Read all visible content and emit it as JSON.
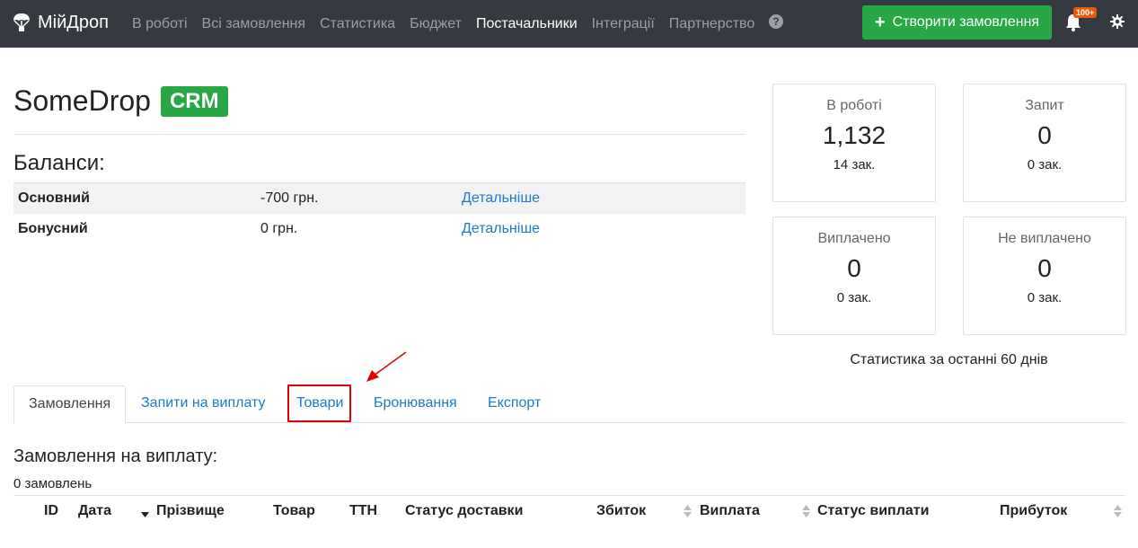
{
  "navbar": {
    "brand": "МійДроп",
    "links": [
      "В роботі",
      "Всі замовлення",
      "Статистика",
      "Бюджет",
      "Постачальники",
      "Інтеграції",
      "Партнерство"
    ],
    "active_link": "Постачальники",
    "help": "?",
    "create_button": "Створити замовлення",
    "notifications_badge": "100+"
  },
  "header": {
    "title": "SomeDrop",
    "badge": "CRM"
  },
  "balances": {
    "title": "Баланси:",
    "rows": [
      {
        "name": "Основний",
        "value": "-700 грн.",
        "link": "Детальніше"
      },
      {
        "name": "Бонусний",
        "value": "0 грн.",
        "link": "Детальніше"
      }
    ]
  },
  "stats": {
    "cards": [
      {
        "label": "В роботі",
        "value": "1,132",
        "count": "14 зак."
      },
      {
        "label": "Запит",
        "value": "0",
        "count": "0 зак."
      },
      {
        "label": "Виплачено",
        "value": "0",
        "count": "0 зак."
      },
      {
        "label": "Не виплачено",
        "value": "0",
        "count": "0 зак."
      }
    ],
    "note": "Статистика за останні 60 днів"
  },
  "tabs": {
    "items": [
      "Замовлення",
      "Запити на виплату",
      "Товари",
      "Бронювання",
      "Експорт"
    ],
    "active": "Замовлення",
    "highlighted": "Товари"
  },
  "orders": {
    "title": "Замовлення на виплату:",
    "count": "0 замовлень",
    "columns": [
      "ID",
      "Дата",
      "Прізвище",
      "Товар",
      "ТТН",
      "Статус доставки",
      "Збиток",
      "Виплата",
      "Статус виплати",
      "Прибуток"
    ]
  },
  "colors": {
    "navbar_bg": "#343a40",
    "accent_green": "#28a745",
    "link_blue": "#1a7bd0",
    "highlight_red": "#e00000",
    "badge_orange": "#e8590c"
  }
}
